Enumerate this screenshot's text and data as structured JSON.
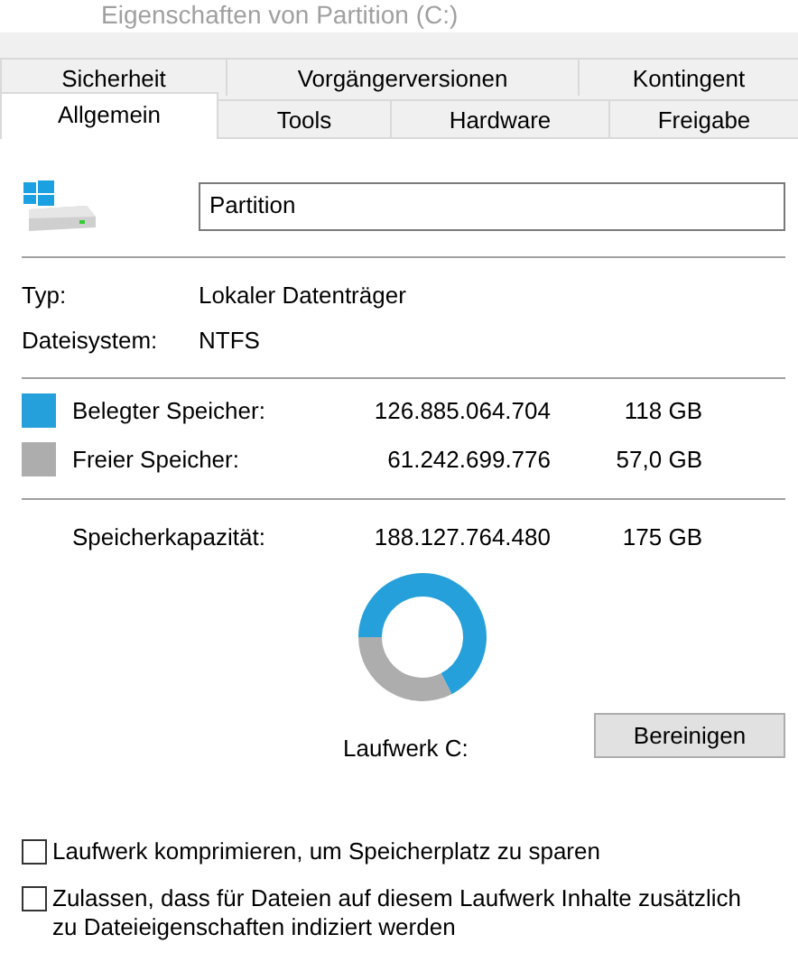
{
  "window": {
    "title": "Eigenschaften von Partition (C:)"
  },
  "tab_rows": [
    [
      {
        "label": "Sicherheit",
        "selected": false
      },
      {
        "label": "Vorgängerversionen",
        "selected": false
      },
      {
        "label": "Kontingent",
        "selected": false
      }
    ],
    [
      {
        "label": "Allgemein",
        "selected": true
      },
      {
        "label": "Tools",
        "selected": false
      },
      {
        "label": "Hardware",
        "selected": false
      },
      {
        "label": "Freigabe",
        "selected": false
      }
    ]
  ],
  "name_field": {
    "value": "Partition"
  },
  "info": [
    {
      "label": "Typ:",
      "value": "Lokaler Datenträger"
    },
    {
      "label": "Dateisystem:",
      "value": "NTFS"
    }
  ],
  "storage": [
    {
      "label": "Belegter Speicher:",
      "bytes": "126.885.064.704",
      "size": "118 GB",
      "color": "#26a0da"
    },
    {
      "label": "Freier Speicher:",
      "bytes": "61.242.699.776",
      "size": "57,0 GB",
      "color": "#adadad"
    }
  ],
  "capacity": {
    "label": "Speicherkapazität:",
    "bytes": "188.127.764.480",
    "size": "175 GB"
  },
  "drive": {
    "label": "Laufwerk C:",
    "chart_data": {
      "type": "donut",
      "values": [
        67.45,
        32.55
      ]
    }
  },
  "cleanup_button": "Bereinigen",
  "options": [
    {
      "label": "Laufwerk komprimieren, um Speicherplatz zu sparen",
      "checked": false
    },
    {
      "label": "Zulassen, dass für Dateien auf diesem Laufwerk Inhalte zusätzlich zu Dateieigenschaften indiziert werden",
      "checked": false
    }
  ]
}
